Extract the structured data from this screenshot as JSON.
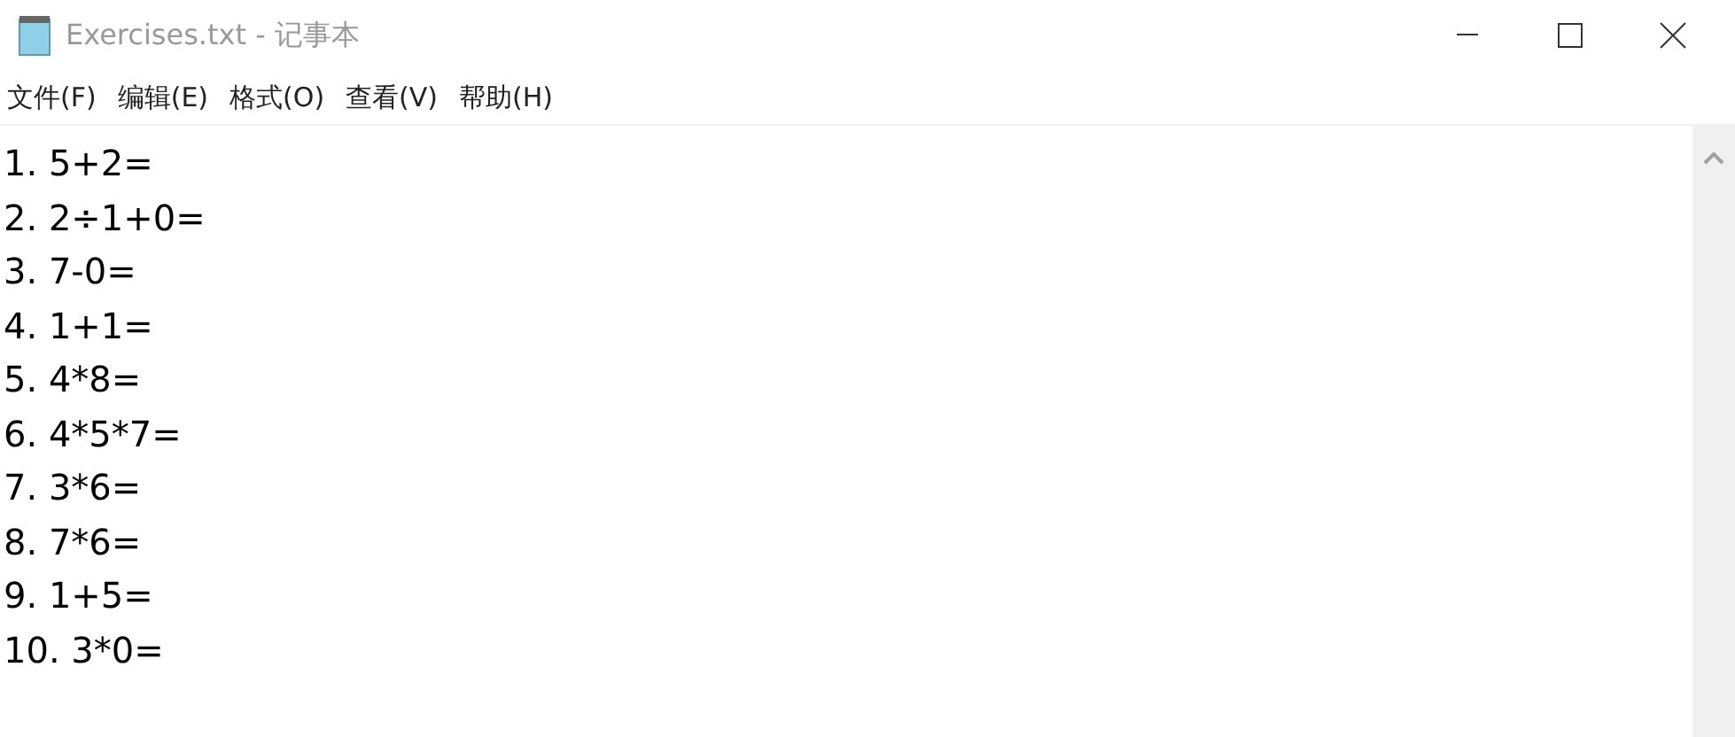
{
  "window": {
    "title": "Exercises.txt - 记事本"
  },
  "menu": [
    "文件(F)",
    "编辑(E)",
    "格式(O)",
    "查看(V)",
    "帮助(H)"
  ],
  "document": {
    "lines": [
      "1. 5+2=",
      "2. 2÷1+0=",
      "3. 7-0=",
      "4. 1+1=",
      "5. 4*8=",
      "6. 4*5*7=",
      "7. 3*6=",
      "8. 7*6=",
      "9. 1+5=",
      "10. 3*0="
    ]
  }
}
